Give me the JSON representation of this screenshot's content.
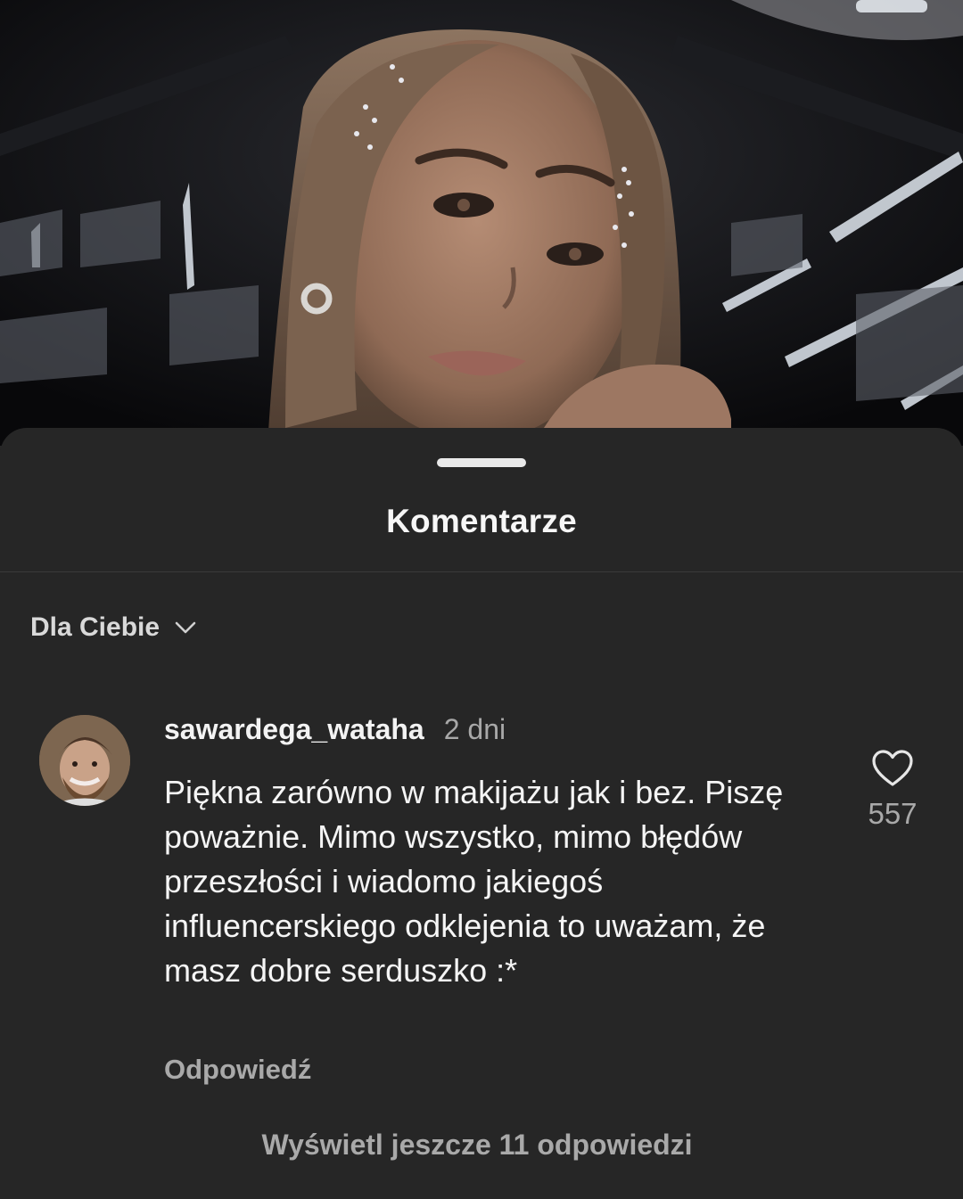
{
  "sheet": {
    "title": "Komentarze",
    "sort_label": "Dla Ciebie"
  },
  "comment": {
    "username": "sawardega_wataha",
    "time": "2 dni",
    "text": "Piękna zarówno w makijażu jak i bez. Piszę poważnie. Mimo wszystko, mimo błędów przeszłości i wiadomo jakiegoś influencerskiego odklejenia to uważam, że masz dobre serduszko :*",
    "like_count": "557",
    "reply_label": "Odpowiedź"
  },
  "replies": {
    "view_more_label": "Wyświetl jeszcze 11 odpowiedzi"
  },
  "icons": {
    "sort": "chevron-down-icon",
    "like": "heart-icon"
  },
  "colors": {
    "sheet_background": "#262626",
    "primary_text": "#f5f5f5",
    "secondary_text": "#a9a9a9"
  }
}
